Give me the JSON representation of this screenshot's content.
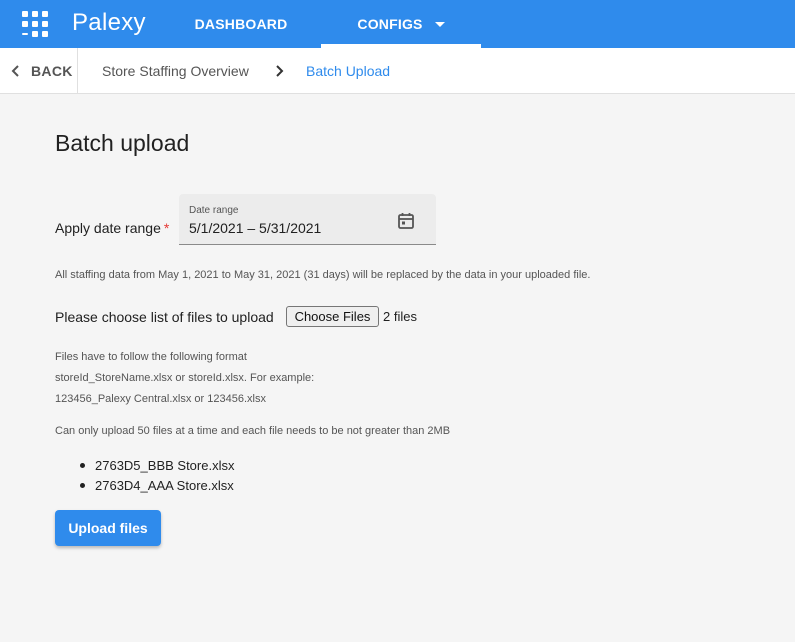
{
  "topbar": {
    "brand": "Palexy",
    "tabs": [
      {
        "label": "DASHBOARD"
      },
      {
        "label": "CONFIGS"
      }
    ],
    "color": "#2f8bec"
  },
  "breadcrumb": {
    "back_label": "BACK",
    "items": [
      "Store Staffing Overview",
      "Batch Upload"
    ]
  },
  "page": {
    "title": "Batch upload",
    "date_label": "Apply date range",
    "required_mark": "*",
    "date_field_label": "Date range",
    "date_value": "5/1/2021 – 5/31/2021",
    "info": "All staffing data from May 1, 2021 to May 31, 2021 (31 days) will be replaced by the data in your uploaded file.",
    "choose_label": "Please choose list of files to upload",
    "choose_button": "Choose Files",
    "file_count": "2 files",
    "format_lines": [
      "Files have to follow the following format",
      "storeId_StoreName.xlsx or storeId.xlsx. For example:",
      "123456_Palexy Central.xlsx or 123456.xlsx"
    ],
    "limit": "Can only upload 50 files at a time and each file needs to be not greater than 2MB",
    "files": [
      "2763D5_BBB Store.xlsx",
      "2763D4_AAA Store.xlsx"
    ],
    "upload_button": "Upload files"
  },
  "icons": {
    "apps": "apps-grid-icon",
    "back": "chevron-left-icon",
    "separator": "chevron-right-icon",
    "calendar": "calendar-icon",
    "dropdown": "caret-down-icon"
  }
}
